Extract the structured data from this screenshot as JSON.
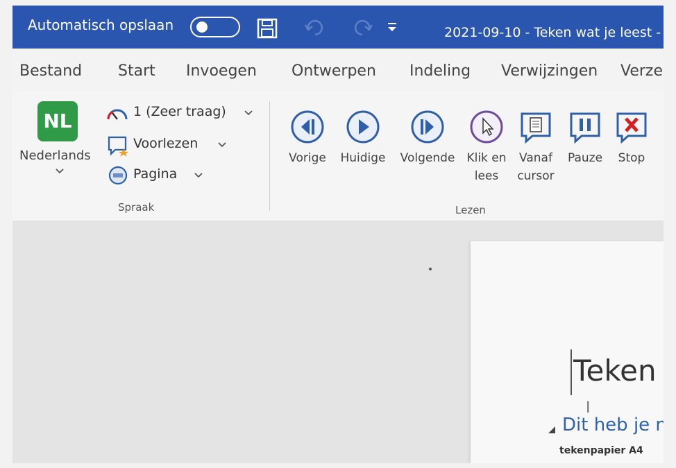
{
  "titlebar": {
    "autosave_label": "Automatisch opslaan",
    "document_title": "2021-09-10 - Teken wat je leest  -",
    "bg_color": "#2a56b0"
  },
  "tabs": [
    {
      "label": "Bestand"
    },
    {
      "label": "Start"
    },
    {
      "label": "Invoegen"
    },
    {
      "label": "Ontwerpen"
    },
    {
      "label": "Indeling"
    },
    {
      "label": "Verwijzingen"
    },
    {
      "label": "Verzen"
    }
  ],
  "speech": {
    "language_badge": "NL",
    "language_label": "Nederlands",
    "speed_label": "1 (Zeer traag)",
    "read_label": "Voorlezen",
    "mode_label": "Pagina",
    "group_label": "Spraak",
    "badge_color": "#2f9a48"
  },
  "reading": {
    "group_label": "Lezen",
    "buttons": [
      {
        "label": "Vorige",
        "icon": "previous-icon"
      },
      {
        "label": "Huidige",
        "icon": "play-icon"
      },
      {
        "label": "Volgende",
        "icon": "next-icon"
      },
      {
        "label_line1": "Klik en",
        "label_line2": "lees",
        "icon": "pointer-icon"
      },
      {
        "label_line1": "Vanaf",
        "label_line2": "cursor",
        "icon": "document-speech-icon"
      },
      {
        "label": "Pauze",
        "icon": "pause-icon"
      },
      {
        "label": "Stop",
        "icon": "stop-icon"
      }
    ],
    "accent_color": "#2e5fa8",
    "pointer_color": "#6d4c9c",
    "stop_color": "#d32020"
  },
  "document": {
    "heading": "Teken",
    "subheading": "Dit heb je n",
    "body_line": "tekenpapier A4"
  }
}
